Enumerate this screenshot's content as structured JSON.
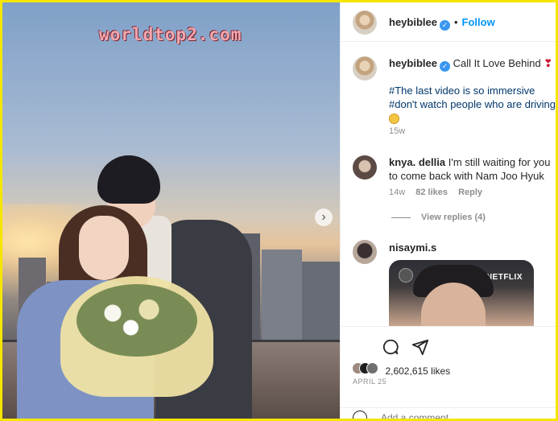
{
  "watermark": "worldtop2.com",
  "post": {
    "username": "heybiblee",
    "follow_label": "Follow",
    "dot": "•",
    "caption_title": "Call It Love Behind",
    "caption_line1": "#The last video is so immersive",
    "caption_line2": "#don't watch people who are driving",
    "caption_time": "15w"
  },
  "comments": [
    {
      "username": "knya. dellia",
      "text_line1": "I'm still waiting for you",
      "text_line2": "to come back with Nam Joo Hyuk",
      "time": "14w",
      "likes": "82 likes",
      "reply": "Reply",
      "view_replies": "View replies (4)"
    },
    {
      "username": "nisaymi.s",
      "video_brand": "NETFLIX"
    }
  ],
  "footer": {
    "likes": "2,602,615 likes",
    "date": "APRIL 25",
    "add_comment_placeholder": "Add a comment..."
  },
  "icons": {
    "verified": "verified-badge-icon",
    "heart": "heart-icon",
    "comment": "comment-icon",
    "share": "share-icon",
    "next": "chevron-right-icon",
    "emoji": "emoji-icon"
  },
  "colors": {
    "frame": "#f5e600",
    "follow": "#0095f6",
    "verified": "#3897f0",
    "muted": "#8e8e8e"
  }
}
